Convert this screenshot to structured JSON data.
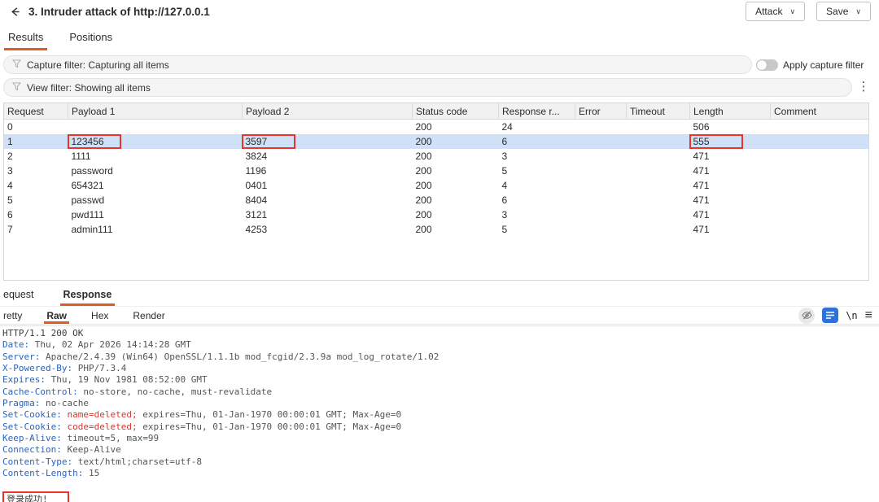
{
  "colors": {
    "accent": "#e05a28",
    "selection": "#cfe0f7",
    "annot": "#e8352c",
    "hname": "#2a63bd",
    "hval": "#555555",
    "hred": "#cf3a33"
  },
  "glyphs": {
    "caret": "∨",
    "kebab": "⋮",
    "menu": "≡",
    "newline_label": "\\n"
  },
  "window": {
    "title": "3. Intruder attack of http://127.0.0.1",
    "attack_button": "Attack",
    "save_button": "Save"
  },
  "tabs": {
    "results": "Results",
    "positions": "Positions"
  },
  "filters": {
    "capture_label": "Capture filter: Capturing all items",
    "apply_capture_label": "Apply capture filter",
    "apply_capture_state": "off",
    "view_label": "View filter: Showing all items"
  },
  "results_table": {
    "columns": [
      "Request",
      "Payload 1",
      "Payload 2",
      "Status code",
      "Response r...",
      "Error",
      "Timeout",
      "Length",
      "Comment"
    ],
    "rows": [
      {
        "request": "0",
        "payload1": "",
        "payload2": "",
        "status": "200",
        "received": "24",
        "error": "",
        "timeout": "",
        "length": "506",
        "comment": "",
        "selected": false,
        "boxed": []
      },
      {
        "request": "1",
        "payload1": "123456",
        "payload2": "3597",
        "status": "200",
        "received": "6",
        "error": "",
        "timeout": "",
        "length": "555",
        "comment": "",
        "selected": true,
        "boxed": [
          "payload1",
          "payload2",
          "length"
        ]
      },
      {
        "request": "2",
        "payload1": "1111",
        "payload2": "3824",
        "status": "200",
        "received": "3",
        "error": "",
        "timeout": "",
        "length": "471",
        "comment": "",
        "selected": false,
        "boxed": []
      },
      {
        "request": "3",
        "payload1": "password",
        "payload2": "1196",
        "status": "200",
        "received": "5",
        "error": "",
        "timeout": "",
        "length": "471",
        "comment": "",
        "selected": false,
        "boxed": []
      },
      {
        "request": "4",
        "payload1": "654321",
        "payload2": "0401",
        "status": "200",
        "received": "4",
        "error": "",
        "timeout": "",
        "length": "471",
        "comment": "",
        "selected": false,
        "boxed": []
      },
      {
        "request": "5",
        "payload1": "passwd",
        "payload2": "8404",
        "status": "200",
        "received": "6",
        "error": "",
        "timeout": "",
        "length": "471",
        "comment": "",
        "selected": false,
        "boxed": []
      },
      {
        "request": "6",
        "payload1": "pwd111",
        "payload2": "3121",
        "status": "200",
        "received": "3",
        "error": "",
        "timeout": "",
        "length": "471",
        "comment": "",
        "selected": false,
        "boxed": []
      },
      {
        "request": "7",
        "payload1": "admin111",
        "payload2": "4253",
        "status": "200",
        "received": "5",
        "error": "",
        "timeout": "",
        "length": "471",
        "comment": "",
        "selected": false,
        "boxed": []
      }
    ]
  },
  "bottom_tabs": {
    "request": "equest",
    "response": "Response"
  },
  "view_tabs": {
    "pretty": "retty",
    "raw": "Raw",
    "hex": "Hex",
    "render": "Render"
  },
  "response": {
    "lines": [
      [
        {
          "t": "HTTP/1.1 200 OK",
          "c": "p"
        }
      ],
      [
        {
          "t": "Date:",
          "c": "n"
        },
        {
          "t": " Thu, 02 Apr 2026 14:14:28 GMT",
          "c": "v"
        }
      ],
      [
        {
          "t": "Server:",
          "c": "n"
        },
        {
          "t": " Apache/2.4.39 (Win64) OpenSSL/1.1.1b mod_fcgid/2.3.9a mod_log_rotate/1.02",
          "c": "v"
        }
      ],
      [
        {
          "t": "X-Powered-By:",
          "c": "n"
        },
        {
          "t": " PHP/7.3.4",
          "c": "v"
        }
      ],
      [
        {
          "t": "Expires:",
          "c": "n"
        },
        {
          "t": " Thu, 19 Nov 1981 08:52:00 GMT",
          "c": "v"
        }
      ],
      [
        {
          "t": "Cache-Control:",
          "c": "n"
        },
        {
          "t": " no-store, no-cache, must-revalidate",
          "c": "v"
        }
      ],
      [
        {
          "t": "Pragma:",
          "c": "n"
        },
        {
          "t": " no-cache",
          "c": "v"
        }
      ],
      [
        {
          "t": "Set-Cookie:",
          "c": "n"
        },
        {
          "t": " ",
          "c": "v"
        },
        {
          "t": "name=deleted;",
          "c": "r"
        },
        {
          "t": " expires=Thu, 01-Jan-1970 00:00:01 GMT; Max-Age=0",
          "c": "v"
        }
      ],
      [
        {
          "t": "Set-Cookie:",
          "c": "n"
        },
        {
          "t": " ",
          "c": "v"
        },
        {
          "t": "code=deleted;",
          "c": "r"
        },
        {
          "t": " expires=Thu, 01-Jan-1970 00:00:01 GMT; Max-Age=0",
          "c": "v"
        }
      ],
      [
        {
          "t": "Keep-Alive:",
          "c": "n"
        },
        {
          "t": " timeout=5, max=99",
          "c": "v"
        }
      ],
      [
        {
          "t": "Connection:",
          "c": "n"
        },
        {
          "t": " Keep-Alive",
          "c": "v"
        }
      ],
      [
        {
          "t": "Content-Type:",
          "c": "n"
        },
        {
          "t": " text/html;charset=utf-8",
          "c": "v"
        }
      ],
      [
        {
          "t": "Content-Length:",
          "c": "n"
        },
        {
          "t": " 15",
          "c": "v"
        }
      ],
      [],
      [
        {
          "t": "登录成功!",
          "c": "p",
          "box": true
        }
      ]
    ]
  }
}
